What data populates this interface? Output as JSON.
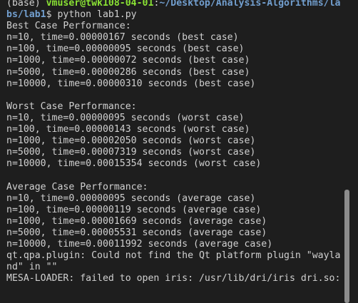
{
  "prompt": {
    "env": "(base) ",
    "user_host": "vmuser@twk108-04-01",
    "colon": ":",
    "path_part1": "~/Desktop/Analysis-Algorithms/la",
    "path_part2": "bs/lab1",
    "command": "$ python lab1.py"
  },
  "output": [
    "Best Case Performance:",
    "n=10, time=0.00000167 seconds (best case)",
    "n=100, time=0.00000095 seconds (best case)",
    "n=1000, time=0.00000072 seconds (best case)",
    "n=5000, time=0.00000286 seconds (best case)",
    "n=10000, time=0.00000310 seconds (best case)",
    "",
    "Worst Case Performance:",
    "n=10, time=0.00000095 seconds (worst case)",
    "n=100, time=0.00000143 seconds (worst case)",
    "n=1000, time=0.00002050 seconds (worst case)",
    "n=5000, time=0.00007319 seconds (worst case)",
    "n=10000, time=0.00015354 seconds (worst case)",
    "",
    "Average Case Performance:",
    "n=10, time=0.00000095 seconds (average case)",
    "n=100, time=0.00000119 seconds (average case)",
    "n=1000, time=0.00001669 seconds (average case)",
    "n=5000, time=0.00005531 seconds (average case)",
    "n=10000, time=0.00011992 seconds (average case)",
    "qt.qpa.plugin: Could not find the Qt platform plugin \"wayla",
    "nd\" in \"\"",
    "MESA-LOADER: failed to open iris: /usr/lib/dri/iris dri.so:"
  ],
  "colors": {
    "background": "#1e1e1e",
    "text": "#d0d0d0",
    "user_host": "#8ae234",
    "path": "#729fcf",
    "scrollbar_thumb": "#8c8c8c"
  }
}
